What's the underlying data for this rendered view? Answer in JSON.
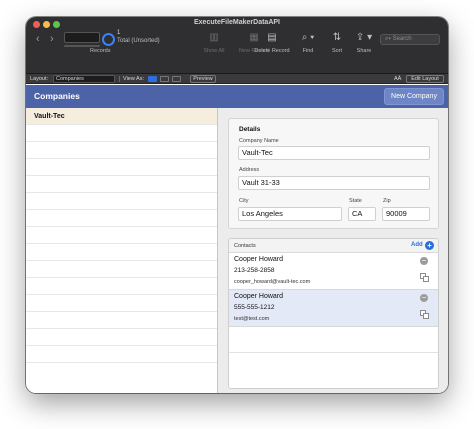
{
  "window": {
    "title": "ExecuteFileMakerDataAPI"
  },
  "toolbar": {
    "record_count": "1",
    "record_total": "Total (Unsorted)",
    "records_label": "Records",
    "show_all": "Show All",
    "new_record": "New Record",
    "delete_record": "Delete Record",
    "find": "Find",
    "sort": "Sort",
    "share": "Share",
    "search_placeholder": "Search"
  },
  "layout_bar": {
    "layout_label": "Layout:",
    "layout_value": "Companies",
    "view_as_label": "View As:",
    "preview_label": "Preview",
    "font_icon": "AÂ",
    "edit_layout_label": "Edit Layout"
  },
  "header": {
    "title": "Companies",
    "new_company_label": "New Company",
    "color": "#4c63a7"
  },
  "companies": [
    {
      "name": "Vault-Tec",
      "selected": true
    }
  ],
  "details": {
    "title": "Details",
    "company_name_label": "Company Name",
    "company_name": "Vault-Tec",
    "address_label": "Address",
    "address": "Vault 31-33",
    "city_label": "City",
    "city": "Los Angeles",
    "state_label": "State",
    "state": "CA",
    "zip_label": "Zip",
    "zip": "90009"
  },
  "contacts": {
    "title": "Contacts",
    "add_label": "Add",
    "items": [
      {
        "name": "Cooper Howard",
        "phone": "213-258-2858",
        "email": "cooper_howard@vault-tec.com",
        "selected": false
      },
      {
        "name": "Cooper Howard",
        "phone": "555-555-1212",
        "email": "test@test.com",
        "selected": true
      }
    ]
  },
  "icons": {
    "nav_back": "chevron-left-icon",
    "nav_forward": "chevron-right-icon",
    "find": "magnifier-icon",
    "sort": "sort-arrows-icon",
    "share": "share-icon",
    "add": "plus-circle-icon",
    "remove": "minus-circle-icon",
    "duplicate": "duplicate-icon"
  },
  "colors": {
    "accent": "#2b6fd6",
    "selected_row": "#f5eede",
    "selected_contact": "#e3e9f7"
  }
}
